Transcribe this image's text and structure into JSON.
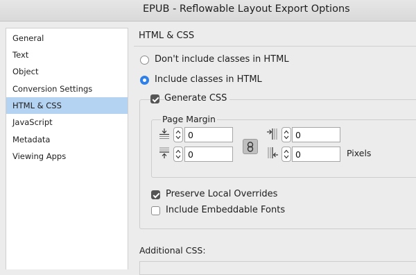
{
  "window": {
    "title": "EPUB - Reflowable Layout Export Options"
  },
  "sidebar": {
    "items": [
      {
        "label": "General"
      },
      {
        "label": "Text"
      },
      {
        "label": "Object"
      },
      {
        "label": "Conversion Settings"
      },
      {
        "label": "HTML & CSS",
        "selected": true
      },
      {
        "label": "JavaScript"
      },
      {
        "label": "Metadata"
      },
      {
        "label": "Viewing Apps"
      }
    ]
  },
  "main": {
    "section_title": "HTML & CSS",
    "class_options": {
      "dont_include": {
        "label": "Don't include classes in HTML",
        "checked": false
      },
      "include": {
        "label": "Include classes in HTML",
        "checked": true
      }
    },
    "generate_css": {
      "label": "Generate CSS",
      "checked": true
    },
    "page_margin": {
      "title": "Page Margin",
      "top": "0",
      "bottom": "0",
      "left": "0",
      "right": "0",
      "units": "Pixels"
    },
    "preserve_local_overrides": {
      "label": "Preserve Local Overrides",
      "checked": true
    },
    "include_embeddable_fonts": {
      "label": "Include Embeddable Fonts",
      "checked": false
    },
    "additional_css": {
      "label": "Additional CSS:"
    }
  },
  "colors": {
    "selection": "#b4d2f1",
    "radio_accent": "#2f7fe8",
    "checkbox_checked": "#555555"
  },
  "icons": {
    "top_margin": "margin-top-icon",
    "bottom_margin": "margin-bottom-icon",
    "left_margin": "margin-left-icon",
    "right_margin": "margin-right-icon",
    "link": "chain-link-icon"
  }
}
